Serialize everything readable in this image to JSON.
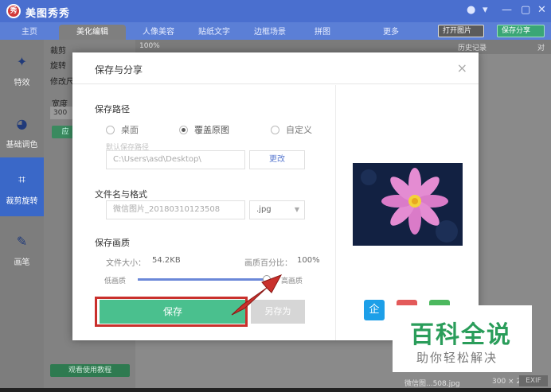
{
  "app": {
    "title": "美图秀秀",
    "logo_glyph": "秀",
    "window_controls": [
      "●",
      "▾",
      "—",
      "▢",
      "✕"
    ]
  },
  "tabs": [
    {
      "label": "主页",
      "active": false
    },
    {
      "label": "美化编辑",
      "active": true
    },
    {
      "label": "人像美容",
      "active": false
    },
    {
      "label": "贴纸文字",
      "active": false
    },
    {
      "label": "边框场景",
      "active": false
    },
    {
      "label": "拼图",
      "active": false
    },
    {
      "label": "更多",
      "active": false
    }
  ],
  "header_buttons": {
    "open": "打开图片",
    "save": "保存分享"
  },
  "toolbar": {
    "zoom": "100%",
    "history": "历史记录",
    "compare": "对比"
  },
  "sidebar": [
    {
      "label": "特效",
      "icon": "magic-wand-icon",
      "active": false
    },
    {
      "label": "基础调色",
      "icon": "palette-icon",
      "active": false
    },
    {
      "label": "裁剪旋转",
      "icon": "crop-icon",
      "active": true
    },
    {
      "label": "画笔",
      "icon": "brush-icon",
      "active": false
    }
  ],
  "left_panel": {
    "crop": "裁剪",
    "rotate": "旋转",
    "resize": "修改尺",
    "width_label": "宽度",
    "width_value": "300",
    "apply": "应",
    "tutorial": "观看使用教程"
  },
  "status": {
    "filename": "微信图...508.jpg",
    "size": "300 × 225",
    "exif": "EXIF"
  },
  "dialog": {
    "title": "保存与分享",
    "close": "×",
    "path_section": "保存路径",
    "radios": [
      {
        "label": "桌面",
        "checked": false
      },
      {
        "label": "覆盖原图",
        "checked": true
      },
      {
        "label": "自定义",
        "checked": false
      }
    ],
    "default_path_hint": "默认保存路径",
    "path_value": "C:\\Users\\asd\\Desktop\\",
    "change_button": "更改",
    "name_section": "文件名与格式",
    "filename_value": "微信图片_20180310123508",
    "format_value": ".jpg",
    "quality_section": "保存画质",
    "file_size_label": "文件大小：",
    "file_size_value": "54.2KB",
    "quality_percent_label": "画质百分比：",
    "quality_percent_value": "100%",
    "quality": 1.0,
    "low_quality": "低画质",
    "high_quality": "高画质",
    "save_button": "保存",
    "save_as_button": "另存为",
    "share_qq_glyph": "企"
  },
  "watermark": {
    "big": "百科全说",
    "small": "助你轻松解决"
  },
  "colors": {
    "accent_blue": "#4a6fcf",
    "save_green": "#4ac08e",
    "annotation_red": "#c9302c",
    "watermark_green": "#2a9d5a"
  }
}
